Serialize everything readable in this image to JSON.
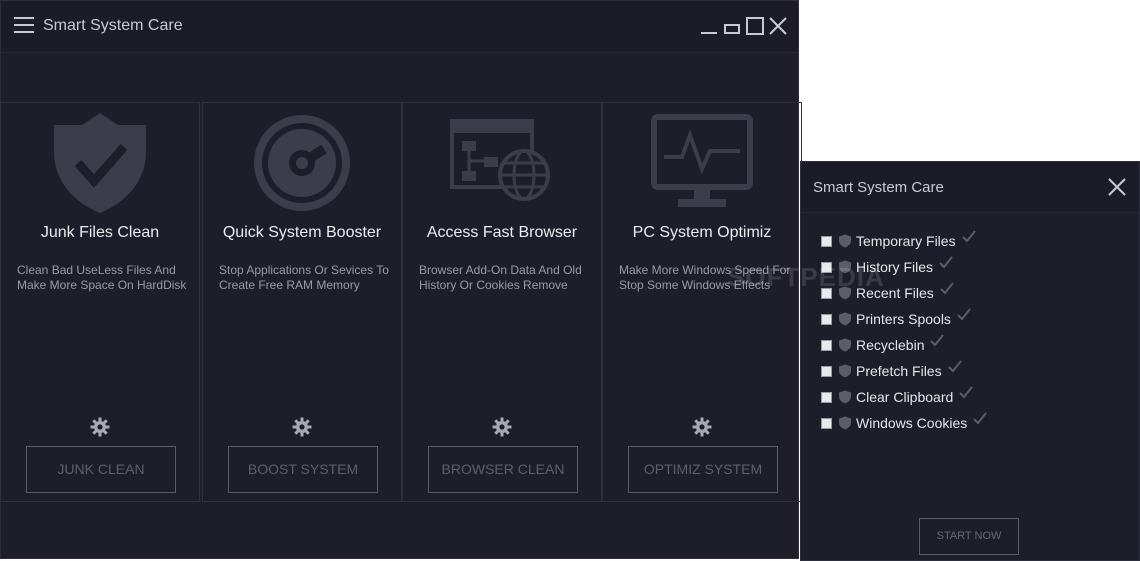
{
  "main_window": {
    "title": "Smart System Care"
  },
  "cards": [
    {
      "title": "Junk Files Clean",
      "desc": "Clean Bad UseLess Files And Make More Space On HardDisk",
      "button": "JUNK CLEAN",
      "icon": "shield-check-icon"
    },
    {
      "title": "Quick System Booster",
      "desc": "Stop Applications Or Sevices To Create Free RAM Memory",
      "button": "BOOST SYSTEM",
      "icon": "speedometer-icon"
    },
    {
      "title": "Access Fast Browser",
      "desc": "Browser Add-On Data And Old History Or Cookies Remove",
      "button": "BROWSER CLEAN",
      "icon": "browser-globe-icon"
    },
    {
      "title": "PC System Optimiz",
      "desc": "Make More Windows Speed For Stop Some Windows Effects",
      "button": "OPTIMIZ SYSTEM",
      "icon": "monitor-pulse-icon"
    }
  ],
  "side_window": {
    "title": "Smart System Care",
    "items": [
      {
        "label": "Temporary Files"
      },
      {
        "label": "History Files"
      },
      {
        "label": "Recent Files"
      },
      {
        "label": "Printers Spools"
      },
      {
        "label": "Recyclebin"
      },
      {
        "label": "Prefetch Files"
      },
      {
        "label": "Clear Clipboard"
      },
      {
        "label": "Windows Cookies"
      }
    ],
    "start_button": "START NOW"
  },
  "watermark": "SOFTPEDIA",
  "colors": {
    "background": "#1d1e2a",
    "icon": "#3b3d4a",
    "text": "#e6e6ea",
    "muted_text": "#9a9ba6"
  }
}
